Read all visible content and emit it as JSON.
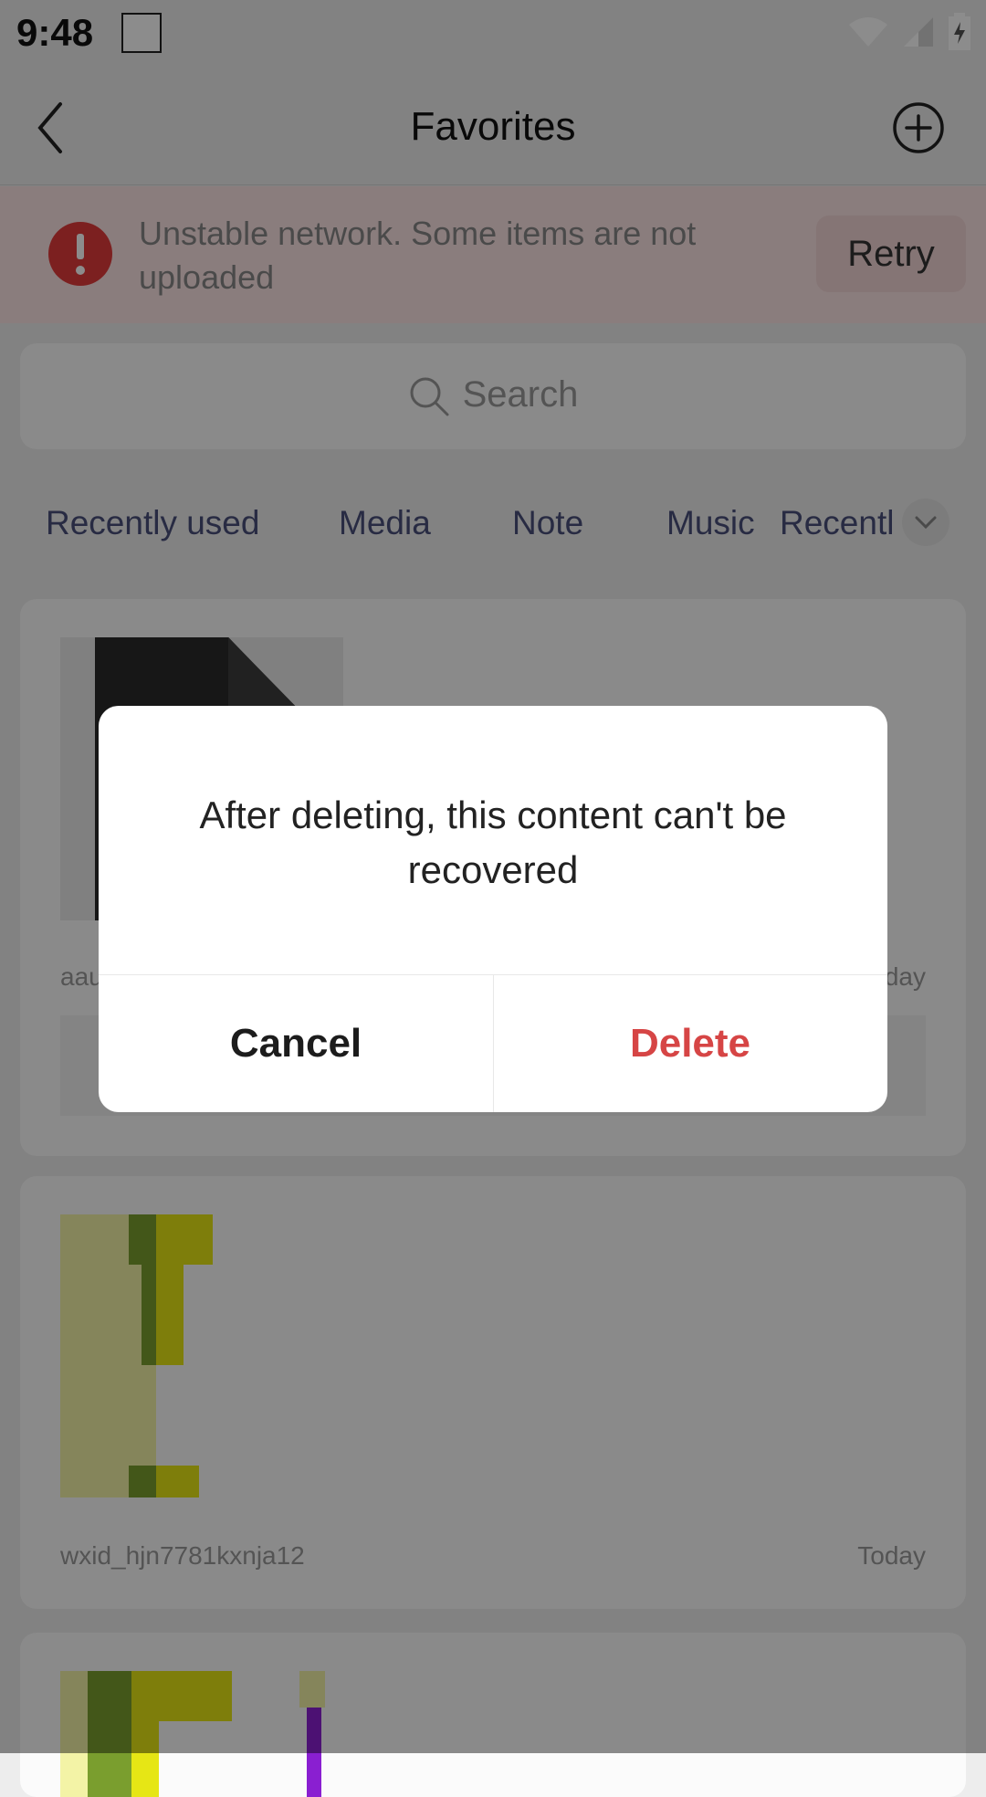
{
  "status": {
    "time": "9:48"
  },
  "header": {
    "title": "Favorites"
  },
  "alert": {
    "text": "Unstable network. Some items are not uploaded",
    "retry": "Retry"
  },
  "search": {
    "placeholder": "Search"
  },
  "tabs": [
    "Recently used",
    "Media",
    "Note",
    "Music",
    "Recentl"
  ],
  "items": [
    {
      "name": "aau",
      "date": "Today"
    },
    {
      "name": "wxid_hjn7781kxnja12",
      "date": "Today"
    }
  ],
  "dialog": {
    "message": "After deleting, this content can't be recovered",
    "cancel": "Cancel",
    "delete": "Delete"
  },
  "colors": {
    "accent_red": "#d64545",
    "alert_bg": "#fbe3e3",
    "tab_text": "#4a4f7a"
  }
}
